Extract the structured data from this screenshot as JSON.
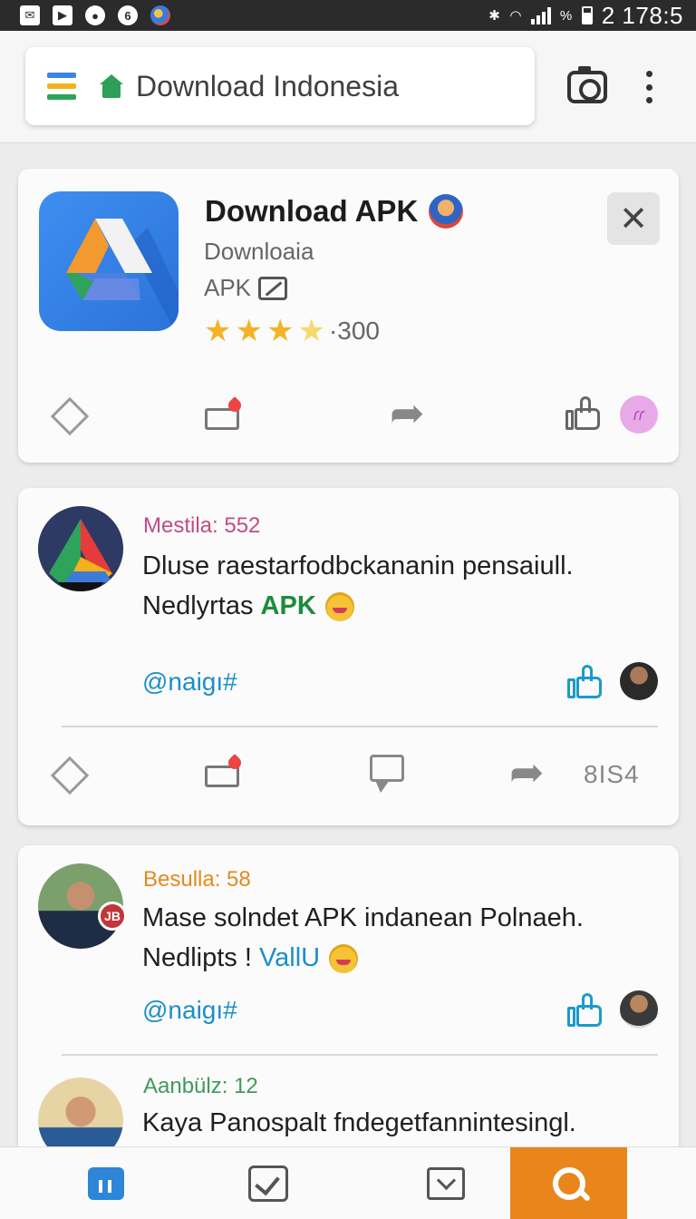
{
  "status_bar": {
    "icons_left": [
      "mail-icon",
      "play-icon",
      "circle-icon",
      "settings-icon",
      "globe-icon"
    ],
    "signal_text": "%",
    "time": "2 178:5"
  },
  "browser": {
    "url_text": "Download Indonesia",
    "icons": [
      "tabs-icon",
      "home-icon",
      "camera-icon",
      "more-icon"
    ]
  },
  "app_card": {
    "title": "Download APK",
    "subtitle": "Downloaia",
    "apk_label": "APK",
    "rating_count": "·300",
    "stars": 3.5,
    "close_symbol": "✕",
    "actions": [
      "bookmark-icon",
      "comment-icon",
      "share-icon",
      "like-icon"
    ],
    "badge_text": "ɾɾ"
  },
  "posts": [
    {
      "username": "Mestila: 552",
      "text_line1": "Dluse raestarfodbckananin pensaiull.",
      "text_line2_prefix": "Nedlyrtas ",
      "text_line2_highlight": "APK",
      "hashtag": "@naigı#",
      "count": "8IS4"
    },
    {
      "username": "Besulla: 58",
      "badge": "JB",
      "text_line1": "Mase solndet APK indanean Polnaeh.",
      "text_line2_prefix": "Nedlipts ! ",
      "text_line2_highlight": "VallU",
      "hashtag": "@naigı#"
    },
    {
      "username": "Aanbülz: 12",
      "text_line1": "Kaya Panospalt fndegetfannintesingl."
    }
  ],
  "bottom_nav": [
    "home-icon",
    "check-icon",
    "inbox-icon",
    "search-icon"
  ],
  "colors": {
    "accent_orange": "#e8861c",
    "link_blue": "#1b8fc9",
    "apk_green": "#1e8b3c",
    "star_yellow": "#f3b324"
  }
}
